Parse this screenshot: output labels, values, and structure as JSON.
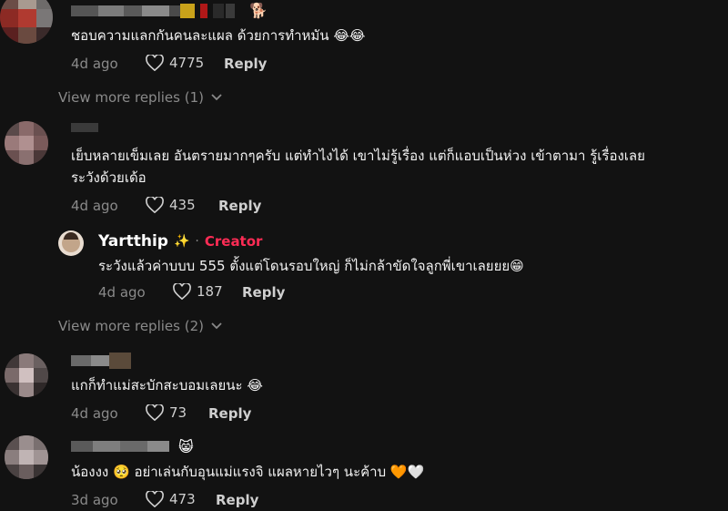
{
  "comments": [
    {
      "text": "ชอบความแลกกันคนละแผล ด้วยการทำหมัน 😂😂",
      "date": "4d ago",
      "likes": "4775",
      "reply_label": "Reply",
      "icon": "heart-outline-icon"
    },
    {
      "text_line1": "เย็บหลายเข็มเลย อันตรายมากๆครับ แต่ทำไงได้ เขาไม่รู้เรื่อง แต่ก็แอบเป็นห่วง เข้าตามา รู้เรื่องเลย",
      "text_line2": "ระวังด้วยเด้อ",
      "date": "4d ago",
      "likes": "435",
      "reply_label": "Reply"
    },
    {
      "text": "แกก็ทำแม่สะบักสะบอมเลยนะ 😂",
      "date": "4d ago",
      "likes": "73",
      "reply_label": "Reply"
    },
    {
      "text": "น้องงง 🥺 อย่าเล่นกับอุนแม่แรงจิ แผลหายไวๆ นะค้าบ 🧡🤍",
      "date": "3d ago",
      "likes": "473",
      "reply_label": "Reply"
    }
  ],
  "creator_reply": {
    "username": "Yartthip",
    "sparkle": "✨",
    "separator": "·",
    "badge": "Creator",
    "text": "ระวังแล้วค่าบบบ 555 ตั้งแต่โดนรอบใหญ่ ก็ไม่กล้าขัดใจลูกพี่เขาเลยยย😁",
    "date": "4d ago",
    "likes": "187",
    "reply_label": "Reply"
  },
  "view_more": [
    {
      "label": "View more replies (1)"
    },
    {
      "label": "View more replies (2)"
    }
  ],
  "username_emojis": {
    "first": "🐕",
    "last": "😸"
  },
  "colors": {
    "background": "#121212",
    "creator_badge": "#fe2c55",
    "meta_text": "#8a8a8a"
  }
}
